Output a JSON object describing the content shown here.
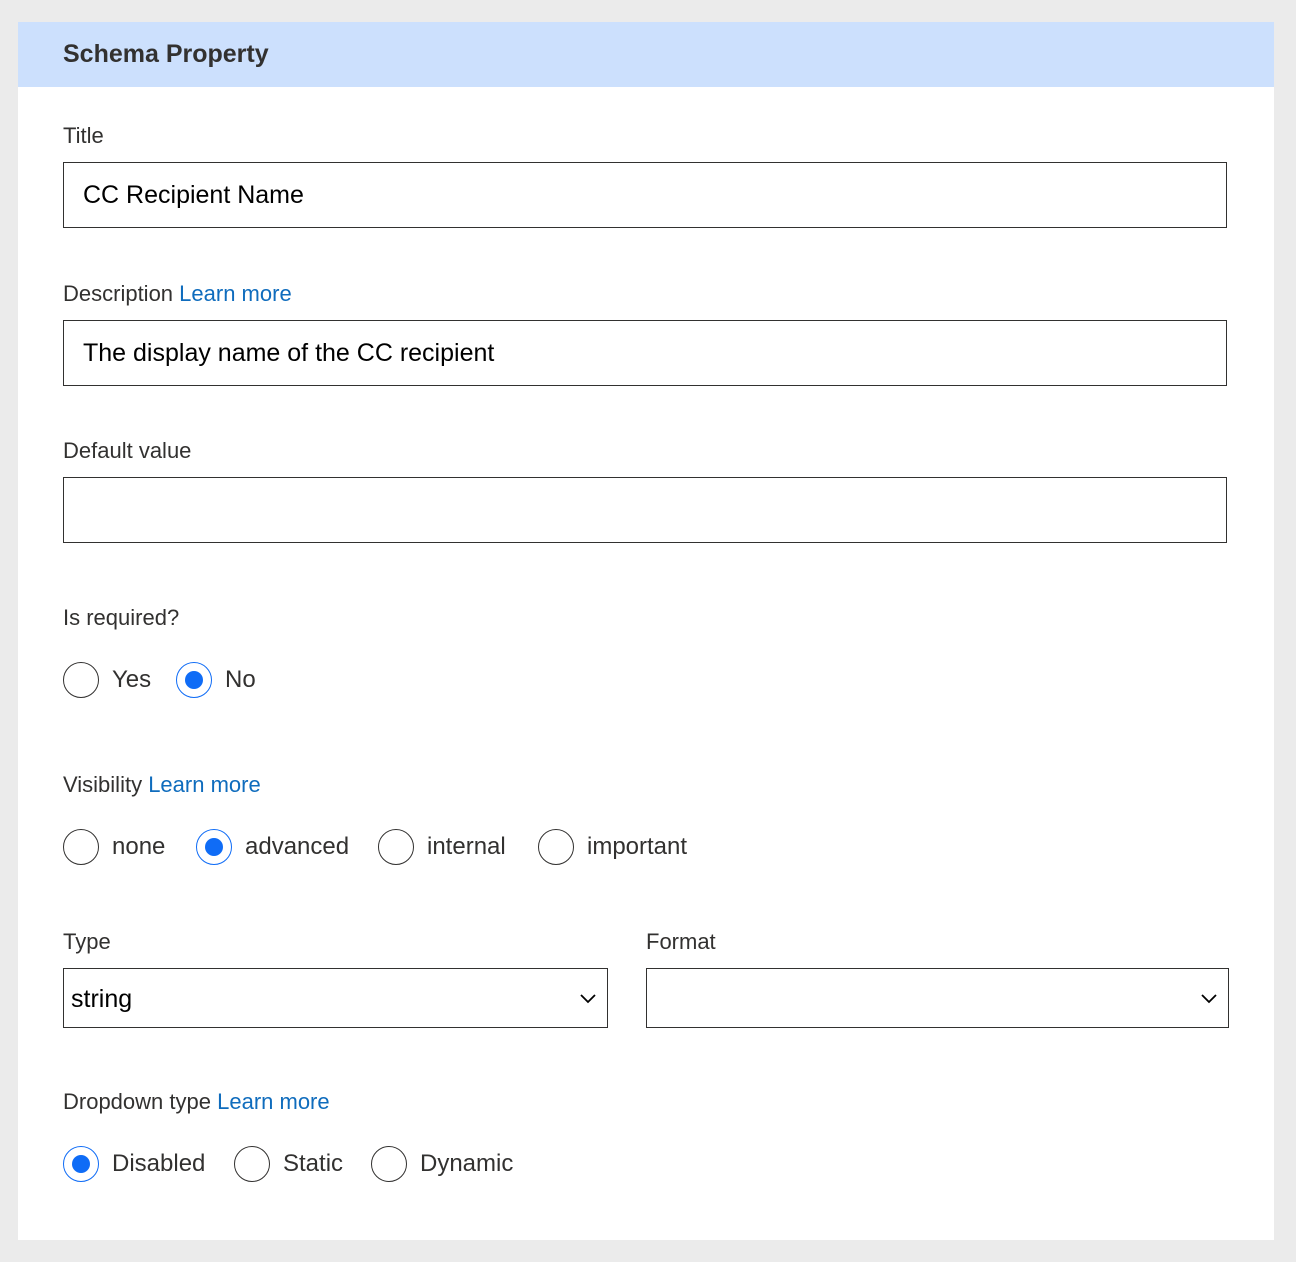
{
  "header": {
    "title": "Schema Property"
  },
  "title_field": {
    "label": "Title",
    "value": "CC Recipient Name"
  },
  "description_field": {
    "label": "Description",
    "link": "Learn more",
    "value": "The display name of the CC recipient"
  },
  "default_field": {
    "label": "Default value",
    "value": ""
  },
  "required": {
    "label": "Is required?",
    "options": [
      "Yes",
      "No"
    ],
    "selected": "No"
  },
  "visibility": {
    "label": "Visibility",
    "link": "Learn more",
    "options": [
      "none",
      "advanced",
      "internal",
      "important"
    ],
    "selected": "advanced"
  },
  "type_field": {
    "label": "Type",
    "value": "string"
  },
  "format_field": {
    "label": "Format",
    "value": ""
  },
  "dropdown_type": {
    "label": "Dropdown type",
    "link": "Learn more",
    "options": [
      "Disabled",
      "Static",
      "Dynamic"
    ],
    "selected": "Disabled"
  },
  "colors": {
    "accent": "#0f6cf6",
    "link": "#0f6cbd",
    "header_bg": "#cce0fd"
  },
  "icons": {
    "select_arrow": "chevron-down-icon"
  }
}
